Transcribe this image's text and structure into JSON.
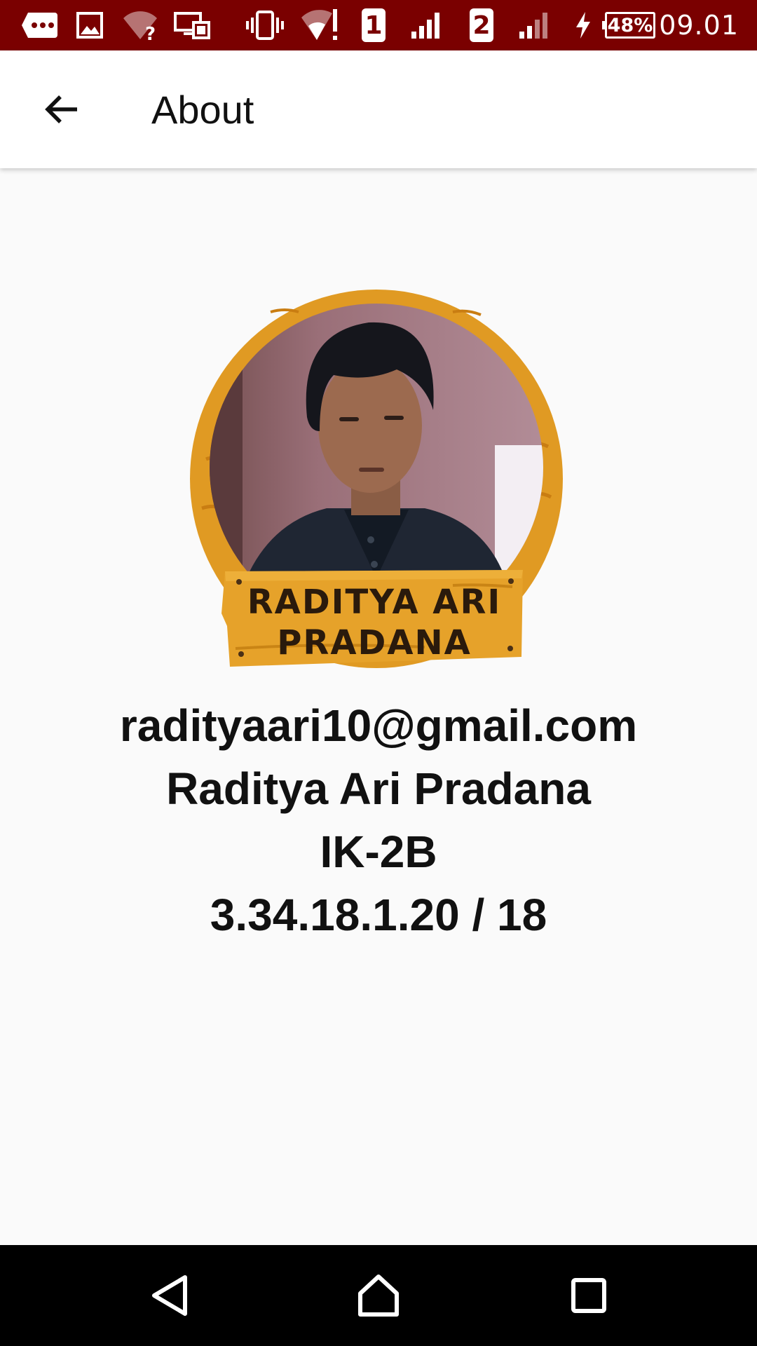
{
  "status_bar": {
    "icons": [
      "more-notifications-icon",
      "image-icon",
      "wifi-unknown-icon",
      "cast-icon",
      "vibrate-icon",
      "wifi-alert-icon",
      "sim-1-icon",
      "signal-icon",
      "sim-2-icon",
      "signal-weak-icon",
      "charging-icon",
      "battery-icon"
    ],
    "sim1_label": "1",
    "sim2_label": "2",
    "battery_percent": "48%",
    "time": "09.01"
  },
  "app_bar": {
    "title": "About",
    "back_icon": "arrow-back-icon"
  },
  "profile": {
    "badge_line1": "RADITYA ARI",
    "badge_line2": "PRADANA",
    "email": "radityaari10@gmail.com",
    "name": "Raditya Ari Pradana",
    "class": "IK-2B",
    "student_id": "3.34.18.1.20 / 18"
  },
  "nav_bar": {
    "back": "nav-back-icon",
    "home": "nav-home-icon",
    "recents": "nav-recents-icon"
  },
  "colors": {
    "status_bar": "#7a0000",
    "app_bar": "#ffffff",
    "background": "#fafafa",
    "badge_orange": "#e09a23",
    "nav_bar": "#000000"
  }
}
